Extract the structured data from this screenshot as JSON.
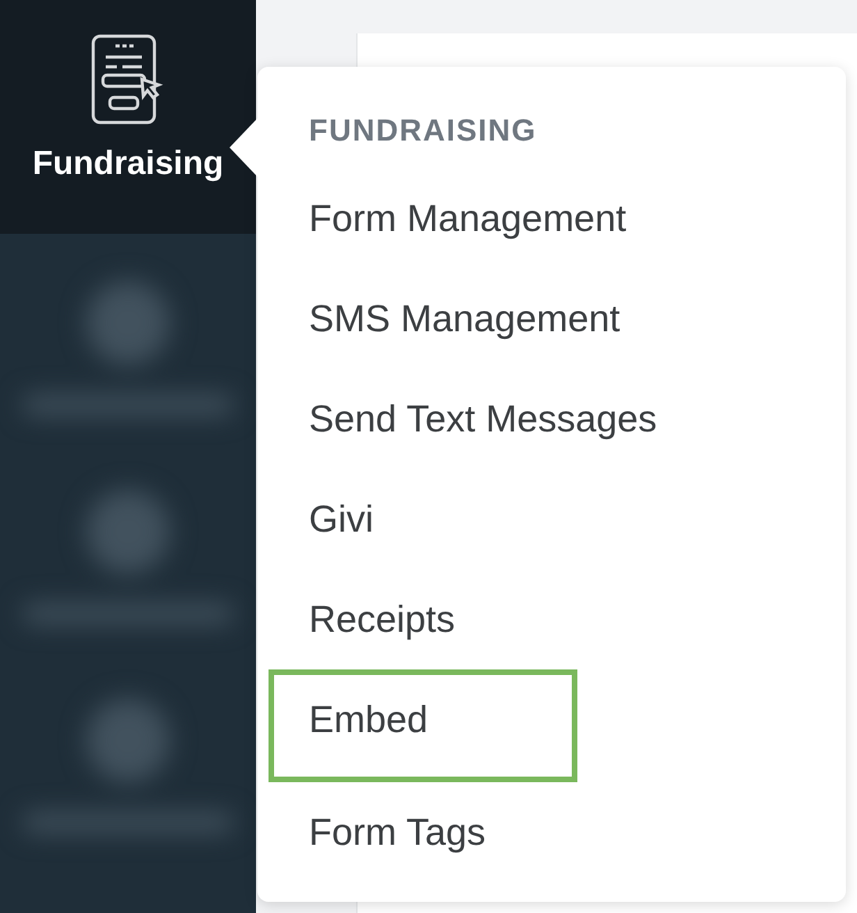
{
  "sidebar": {
    "active_item": {
      "label": "Fundraising",
      "selected": true
    }
  },
  "menu": {
    "heading": "FUNDRAISING",
    "items": [
      {
        "label": "Form Management",
        "highlighted": false
      },
      {
        "label": "SMS Management",
        "highlighted": false
      },
      {
        "label": "Send Text Messages",
        "highlighted": false
      },
      {
        "label": "Givi",
        "highlighted": false
      },
      {
        "label": "Receipts",
        "highlighted": false
      },
      {
        "label": "Embed",
        "highlighted": true
      },
      {
        "label": "Form Tags",
        "highlighted": false
      }
    ]
  }
}
